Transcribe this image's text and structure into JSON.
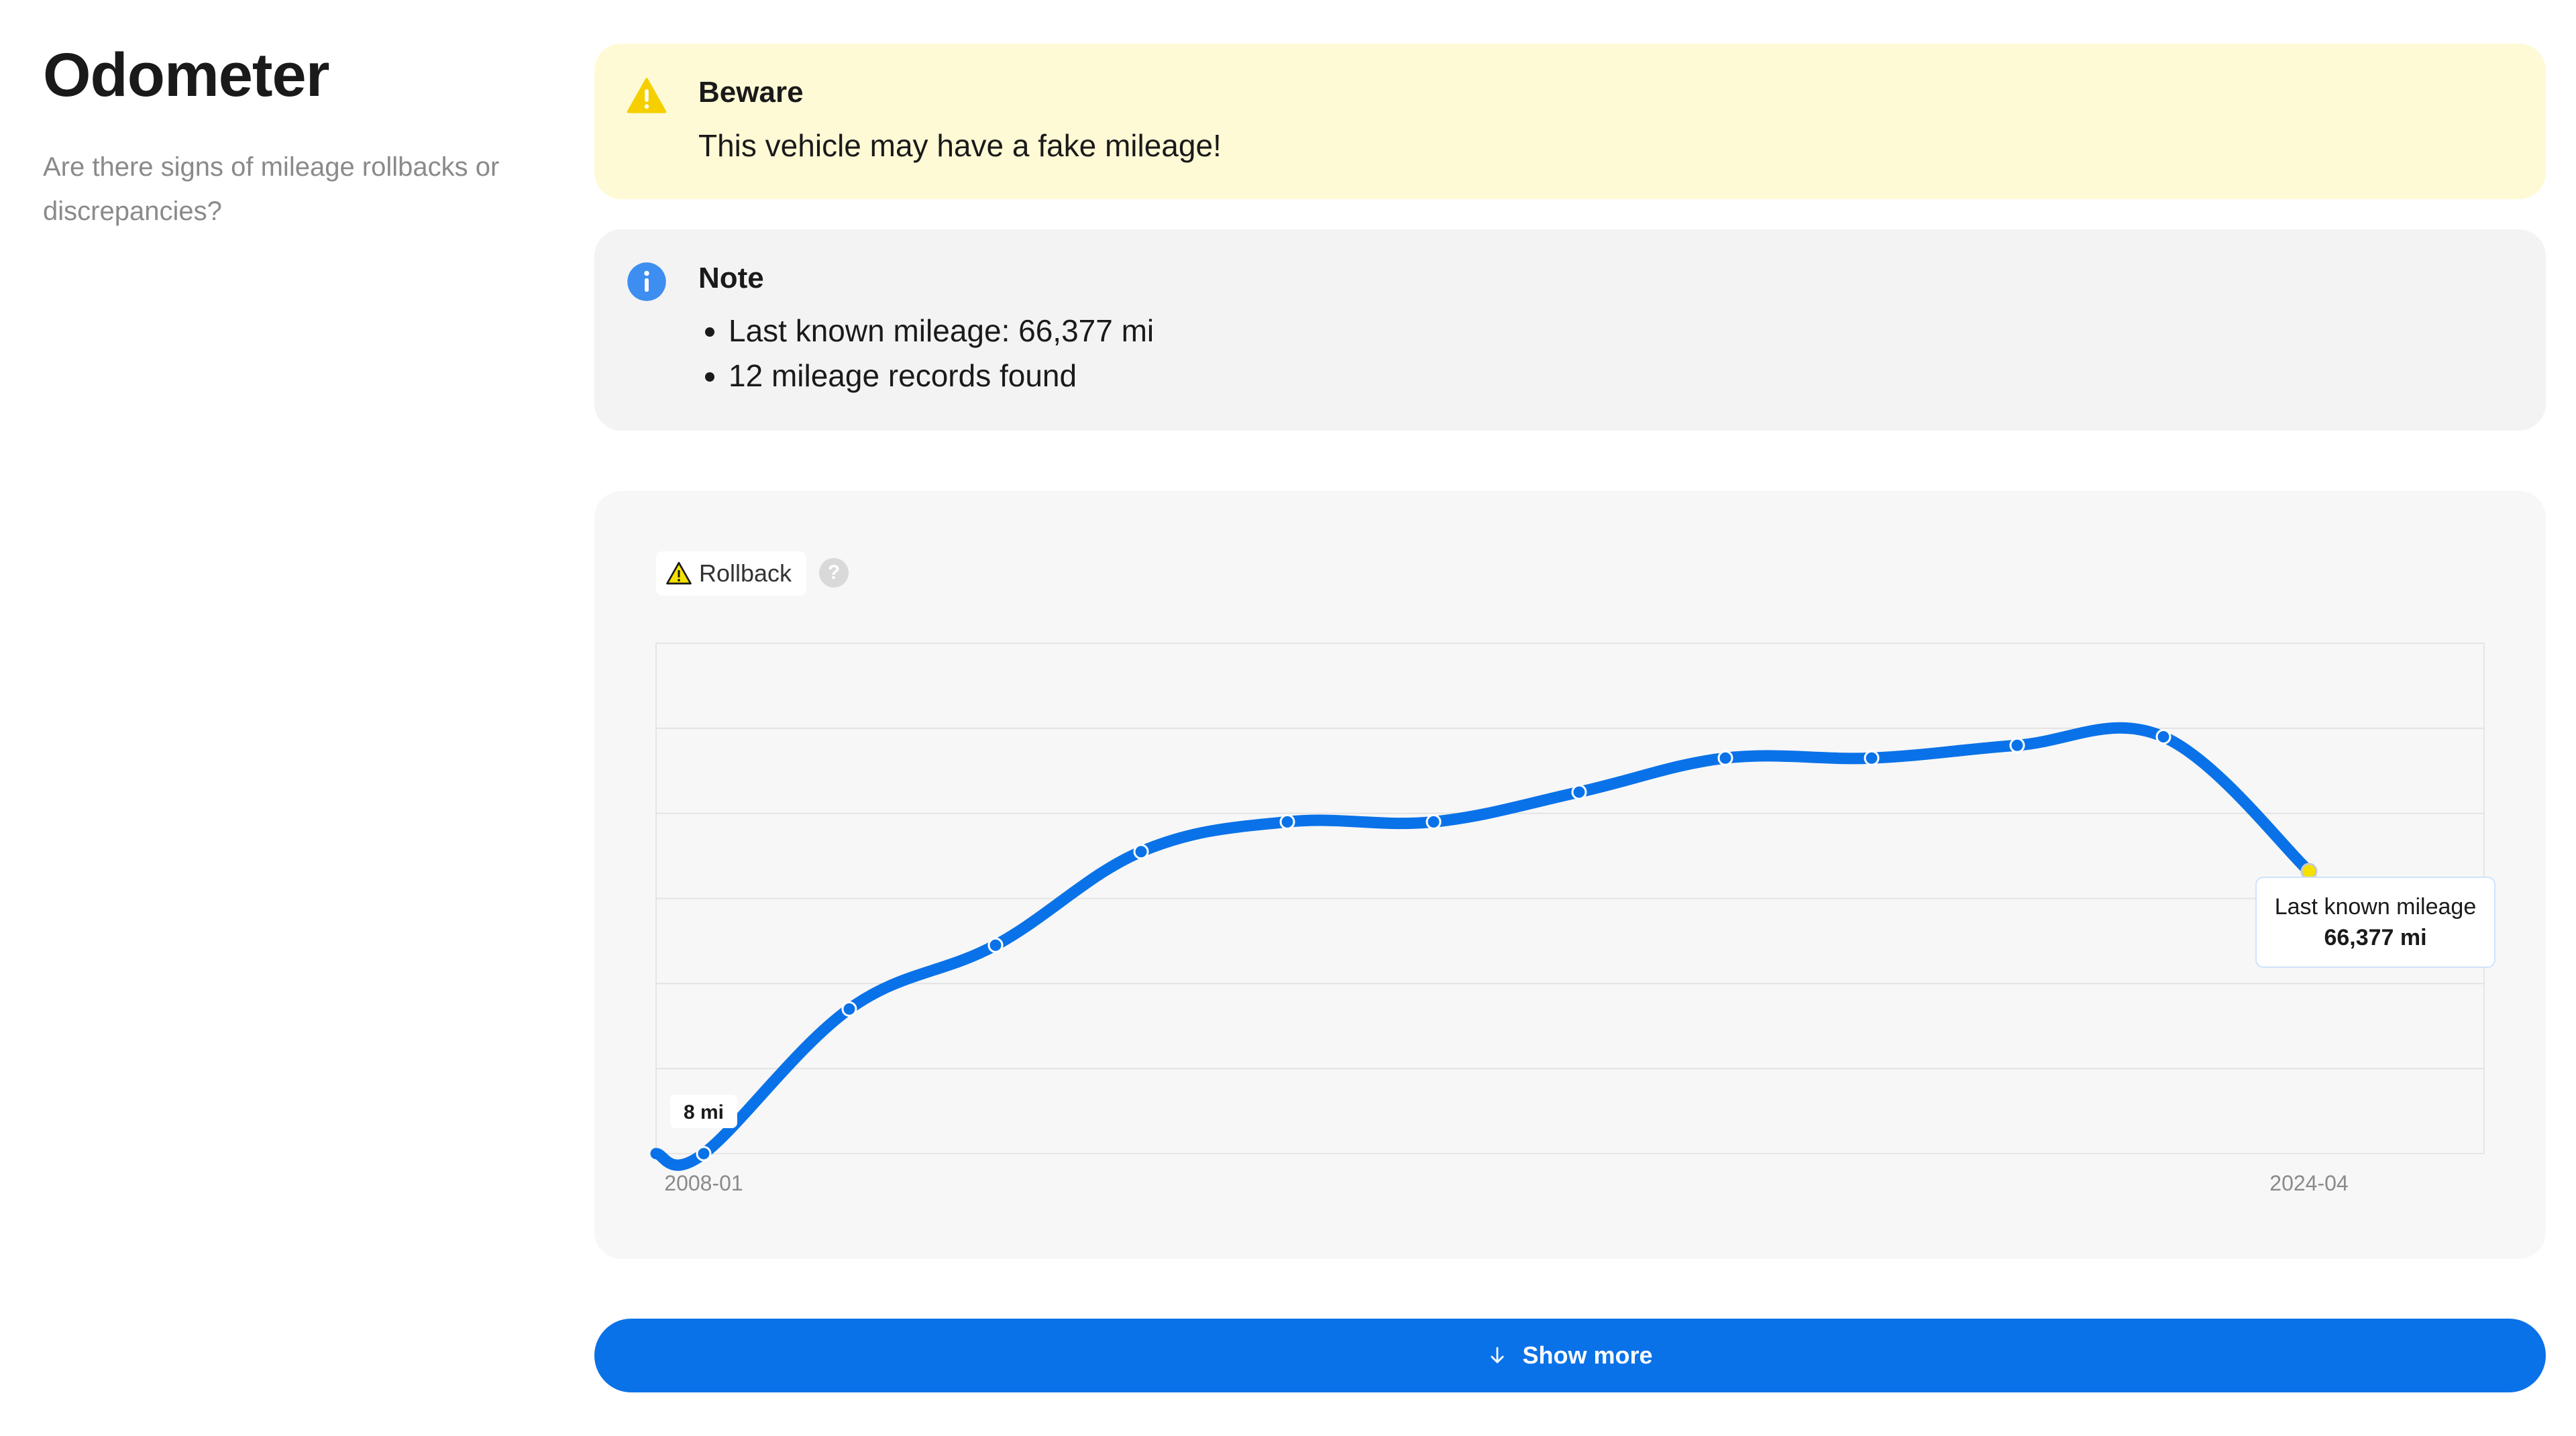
{
  "sidebar": {
    "title": "Odometer",
    "subtitle": "Are there signs of mileage rollbacks or discrepancies?"
  },
  "warning": {
    "title": "Beware",
    "message": "This vehicle may have a fake mileage!",
    "icon": "warning-triangle-icon",
    "color": "#fffad6"
  },
  "note": {
    "title": "Note",
    "icon": "info-icon",
    "items": [
      "Last known mileage: 66,377 mi",
      "12 mileage records found"
    ]
  },
  "legend": {
    "label": "Rollback",
    "icon": "warning-triangle-icon",
    "help_icon": "question-icon",
    "help_glyph": "?"
  },
  "tooltip": {
    "label": "Last known mileage",
    "value": "66,377 mi"
  },
  "start_label": "8 mi",
  "show_more": {
    "label": "Show more",
    "icon": "arrow-down-icon"
  },
  "colors": {
    "line": "#0a72e8",
    "rollback_point": "#f5e100",
    "warning_bg": "#fffad6",
    "note_bg": "#f3f3f3",
    "button": "#0a72e8"
  },
  "chart_data": {
    "type": "line",
    "x": [
      "2008-01",
      "2010-03",
      "2011-09",
      "2013-05",
      "2014-09",
      "2016-03",
      "2017-10",
      "2019-04",
      "2020-10",
      "2022-05",
      "2023-11",
      "2024-04"
    ],
    "y": [
      8,
      34000,
      49000,
      71000,
      78000,
      78000,
      85000,
      93000,
      93000,
      96000,
      98000,
      66377
    ],
    "x_tick_labels": [
      "2008-01",
      "2024-04"
    ],
    "ylim": [
      0,
      120000
    ],
    "grid": true,
    "legend": "top-left",
    "legend_entries": [
      "Rollback"
    ],
    "annotations": [
      {
        "x": "2008-01",
        "text": "8 mi"
      },
      {
        "x": "2024-04",
        "text": "Last known mileage 66,377 mi"
      }
    ]
  }
}
